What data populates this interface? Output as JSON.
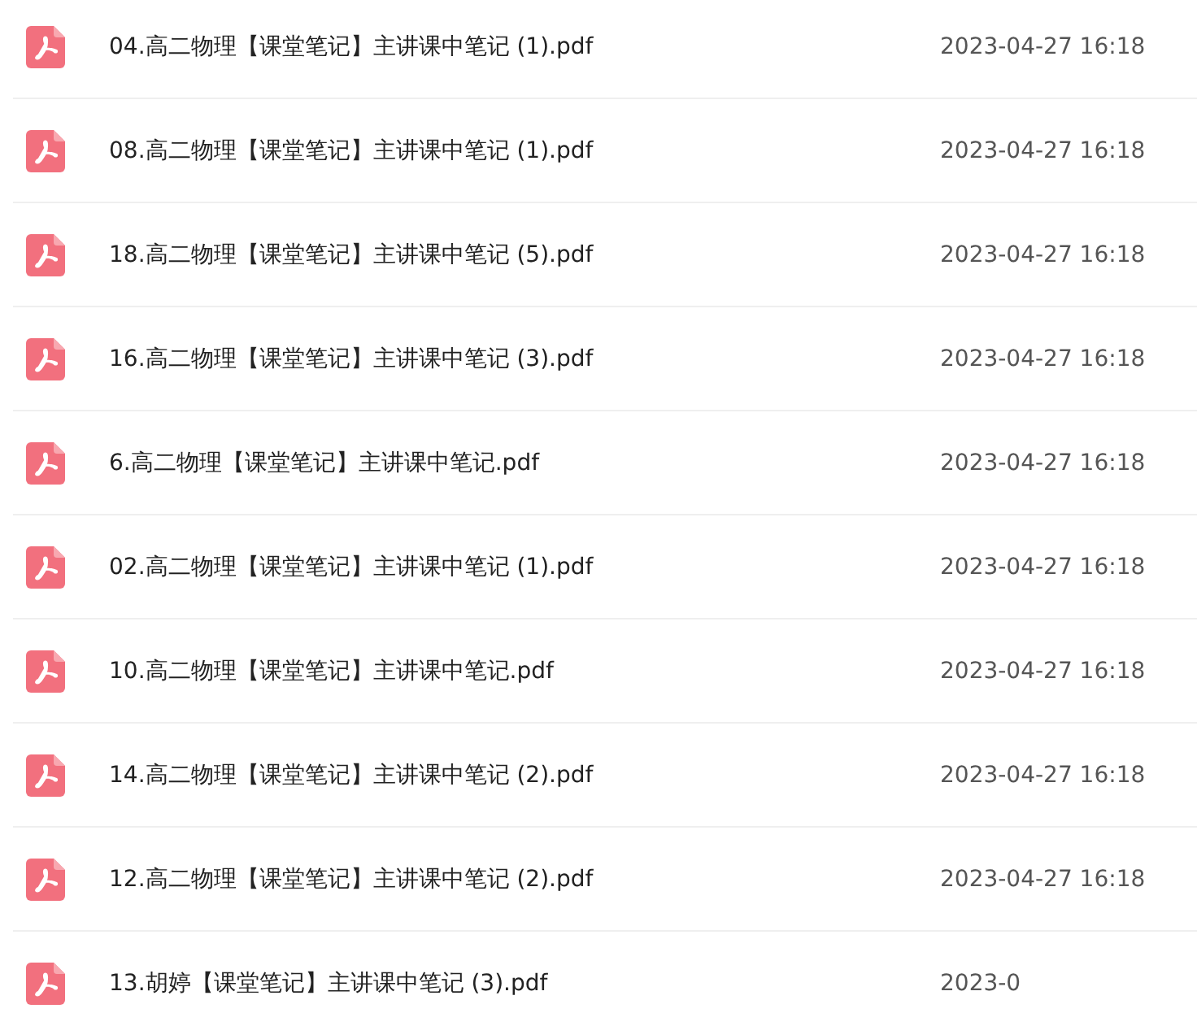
{
  "files": [
    {
      "name": "04.高二物理【课堂笔记】主讲课中笔记 (1).pdf",
      "date": "2023-04-27 16:18"
    },
    {
      "name": "08.高二物理【课堂笔记】主讲课中笔记 (1).pdf",
      "date": "2023-04-27 16:18"
    },
    {
      "name": "18.高二物理【课堂笔记】主讲课中笔记 (5).pdf",
      "date": "2023-04-27 16:18"
    },
    {
      "name": "16.高二物理【课堂笔记】主讲课中笔记 (3).pdf",
      "date": "2023-04-27 16:18"
    },
    {
      "name": "6.高二物理【课堂笔记】主讲课中笔记.pdf",
      "date": "2023-04-27 16:18"
    },
    {
      "name": "02.高二物理【课堂笔记】主讲课中笔记 (1).pdf",
      "date": "2023-04-27 16:18"
    },
    {
      "name": "10.高二物理【课堂笔记】主讲课中笔记.pdf",
      "date": "2023-04-27 16:18"
    },
    {
      "name": "14.高二物理【课堂笔记】主讲课中笔记 (2).pdf",
      "date": "2023-04-27 16:18"
    },
    {
      "name": "12.高二物理【课堂笔记】主讲课中笔记 (2).pdf",
      "date": "2023-04-27 16:18"
    },
    {
      "name": "13.胡婷【课堂笔记】主讲课中笔记 (3).pdf",
      "date": "2023-0"
    }
  ]
}
